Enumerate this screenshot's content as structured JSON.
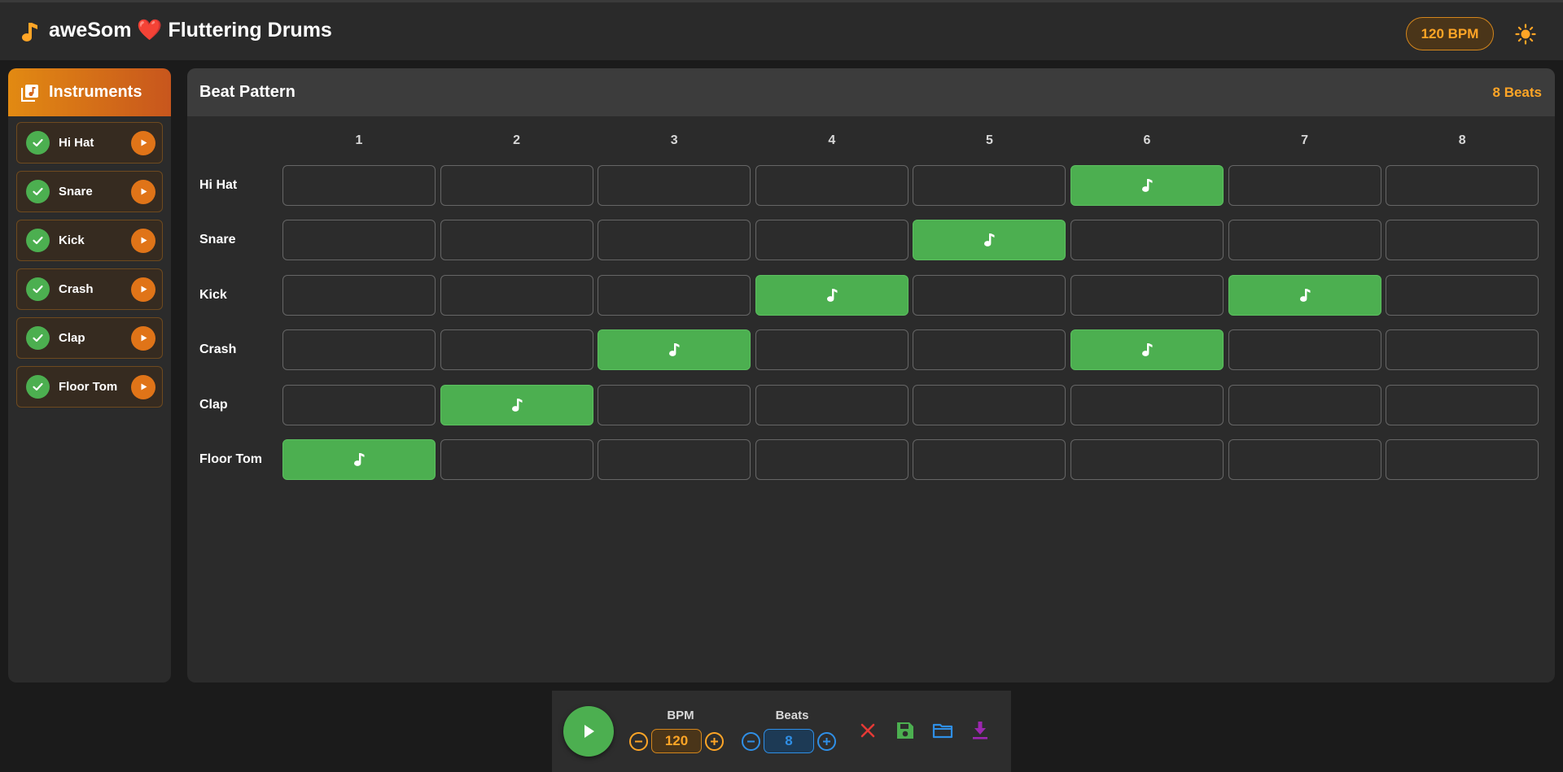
{
  "app": {
    "title": "aweSom ❤️ Fluttering Drums",
    "bpm_badge": "120 BPM"
  },
  "sidebar": {
    "title": "Instruments",
    "items": [
      {
        "label": "Hi Hat",
        "enabled": true
      },
      {
        "label": "Snare",
        "enabled": true
      },
      {
        "label": "Kick",
        "enabled": true
      },
      {
        "label": "Crash",
        "enabled": true
      },
      {
        "label": "Clap",
        "enabled": true
      },
      {
        "label": "Floor Tom",
        "enabled": true
      }
    ]
  },
  "pattern": {
    "title": "Beat Pattern",
    "beat_count_label": "8 Beats",
    "columns": [
      "1",
      "2",
      "3",
      "4",
      "5",
      "6",
      "7",
      "8"
    ],
    "rows": [
      {
        "label": "Hi Hat",
        "steps": [
          0,
          0,
          0,
          0,
          0,
          1,
          0,
          0
        ]
      },
      {
        "label": "Snare",
        "steps": [
          0,
          0,
          0,
          0,
          1,
          0,
          0,
          0
        ]
      },
      {
        "label": "Kick",
        "steps": [
          0,
          0,
          0,
          1,
          0,
          0,
          1,
          0
        ]
      },
      {
        "label": "Crash",
        "steps": [
          0,
          0,
          1,
          0,
          0,
          1,
          0,
          0
        ]
      },
      {
        "label": "Clap",
        "steps": [
          0,
          1,
          0,
          0,
          0,
          0,
          0,
          0
        ]
      },
      {
        "label": "Floor Tom",
        "steps": [
          1,
          0,
          0,
          0,
          0,
          0,
          0,
          0
        ]
      }
    ]
  },
  "controls": {
    "bpm_label": "BPM",
    "bpm_value": "120",
    "beats_label": "Beats",
    "beats_value": "8"
  },
  "colors": {
    "accent": "#ffa526",
    "active_cell": "#4caf50",
    "beats_blue": "#2f8fe6",
    "clear_red": "#e53935",
    "save_green": "#4caf50",
    "download_purple": "#9c27b0"
  },
  "icons": {
    "app": "music-note-icon",
    "theme": "sun-icon",
    "instruments": "library-music-icon",
    "enabled": "check-icon",
    "preview": "play-icon",
    "cell": "music-note-icon",
    "play": "play-icon",
    "decrement": "minus-circle-icon",
    "increment": "plus-circle-icon",
    "clear": "close-icon",
    "save": "save-icon",
    "open": "folder-icon",
    "download": "download-icon"
  }
}
